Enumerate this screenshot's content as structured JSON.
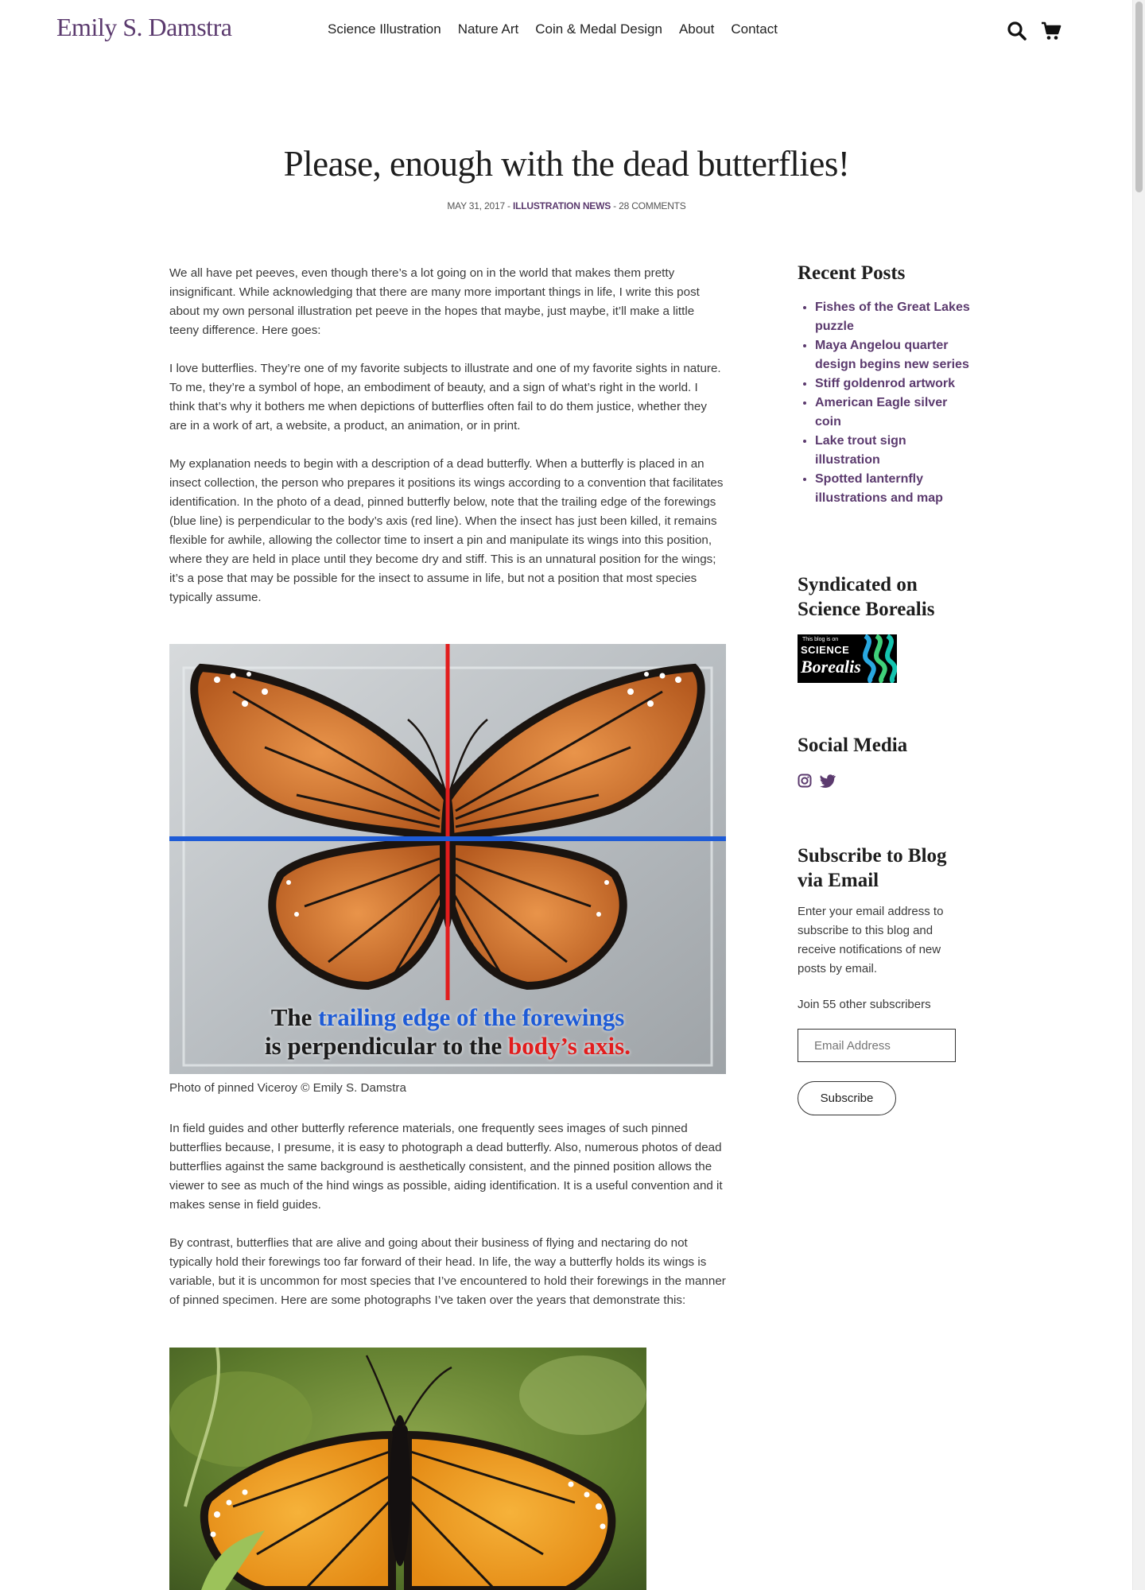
{
  "site": {
    "logo": "Emily S. Damstra",
    "nav": [
      "Science Illustration",
      "Nature Art",
      "Coin & Medal Design",
      "About",
      "Contact"
    ],
    "icons": [
      "search-icon",
      "cart-icon"
    ]
  },
  "post": {
    "title": "Please, enough with the dead butterflies!",
    "date": "MAY 31, 2017",
    "sep1": " - ",
    "category": "ILLUSTRATION NEWS",
    "sep2": " - ",
    "comments": "28 COMMENTS",
    "paragraphs": [
      "We all have pet peeves, even though there’s a lot going on in the world that makes them pretty insignificant. While acknowledging that there are many more important things in life, I write this post about my own personal illustration pet peeve in the hopes that maybe, just maybe, it’ll make a little teeny difference. Here goes:",
      "I love butterflies. They’re one of my favorite subjects to illustrate and one of my favorite sights in nature. To me, they’re a symbol of hope, an embodiment of beauty, and a sign of what’s right in the world. I think that’s why it bothers me when depictions of butterflies often fail to do them justice, whether they are in a work of art, a website, a product, an animation, or in print.",
      "My explanation needs to begin with a description of a dead butterfly. When a butterfly is placed in an insect collection, the person who prepares it positions its wings according to a convention that facilitates identification. In the photo of a dead, pinned butterfly below, note that the trailing edge of the forewings (blue line) is perpendicular to the body’s axis (red line). When the insect has just been killed, it remains flexible for awhile, allowing the collector time to insert a pin and manipulate its wings into this position, where they are held in place until they become dry and stiff. This is an unnatural position for the wings; it’s a pose that may be possible for the insect to assume in life, but not a position that most species typically assume."
    ],
    "figure1": {
      "overlay_line1_a": "The ",
      "overlay_line1_b": "trailing edge of the forewings",
      "overlay_line2_a": "is perpendicular to the ",
      "overlay_line2_b": "body’s axis.",
      "caption": "Photo of pinned Viceroy © Emily S. Damstra"
    },
    "paragraphs2": [
      "In field guides and other butterfly reference materials, one frequently sees images of such pinned butterflies because, I presume, it is easy to photograph a dead butterfly. Also, numerous photos of dead butterflies against the same background is aesthetically consistent, and the pinned position allows the viewer to see as much of the hind wings as possible, aiding identification. It is a useful convention and it makes sense in field guides.",
      "By contrast, butterflies that are alive and going about their business of flying and nectaring do not typically hold their forewings too far forward of their head. In life, the way a butterfly holds its wings is variable, but it is uncommon for most species that I’ve encountered to hold their forewings in the manner of pinned specimen. Here are some photographs I’ve taken over the years that demonstrate this:"
    ]
  },
  "sidebar": {
    "recent_title": "Recent Posts",
    "recent": [
      "Fishes of the Great Lakes puzzle",
      "Maya Angelou quarter design begins new series",
      "Stiff goldenrod artwork",
      "American Eagle silver coin",
      "Lake trout sign illustration",
      "Spotted lanternfly illustrations and map"
    ],
    "syndicated_title": "Syndicated on Science Borealis",
    "badge_small": "This blog is on",
    "badge_big": "SCIENCE",
    "badge_script": "Borealis",
    "social_title": "Social Media",
    "social_icons": [
      "instagram-icon",
      "twitter-icon"
    ],
    "subscribe_title": "Subscribe to Blog via Email",
    "subscribe_desc": "Enter your email address to subscribe to this blog and receive notifications of new posts by email.",
    "join": "Join 55 other subscribers",
    "email_placeholder": "Email Address",
    "subscribe_button": "Subscribe"
  },
  "colors": {
    "accent": "#5b3a6e",
    "blue_line": "#1e5bd6",
    "red_line": "#e21d1d"
  }
}
